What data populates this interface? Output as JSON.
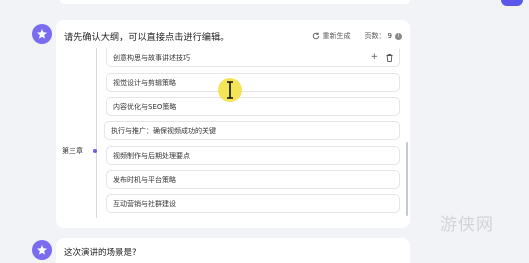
{
  "colors": {
    "accent": "#6a5cf0",
    "avatar": "#7a6cf0",
    "cursor_highlight": "#f3e24a",
    "background": "#f2f3f7"
  },
  "message": {
    "avatar_icon": "star-bot-icon",
    "title": "请先确认大纲，可以直接点击进行编辑。",
    "regenerate_label": "重新生成",
    "pages_label": "页数：",
    "pages_value": "9",
    "info_icon": "info-icon"
  },
  "outline": {
    "rows": [
      {
        "text": "创意构思与故事讲述技巧",
        "icons": [
          "plus-icon",
          "trash-icon"
        ]
      },
      {
        "text": "视觉设计与剪辑策略"
      },
      {
        "text": "内容优化与SEO策略"
      }
    ],
    "chapter": {
      "label": "第三章",
      "title": "执行与推广：确保视频成功的关键"
    },
    "chapter_items": [
      {
        "text": "视频制作与后期处理要点"
      },
      {
        "text": "发布时机与平台策略"
      },
      {
        "text": "互动营销与社群建设"
      }
    ]
  },
  "next_message": {
    "text": "这次演讲的场景是?"
  },
  "watermark": "游侠网"
}
